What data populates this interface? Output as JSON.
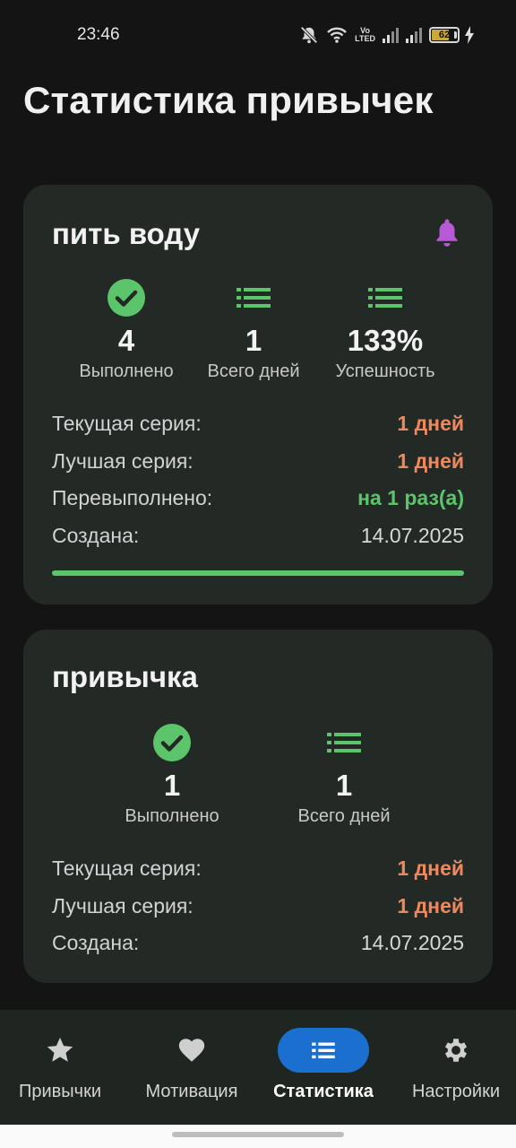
{
  "status_bar": {
    "time": "23:46",
    "volte_top": "Vo",
    "volte_bottom": "LTED",
    "battery": "62",
    "icons": [
      "mute-icon",
      "wifi-icon",
      "volte-icon",
      "signal-icon",
      "signal-icon",
      "battery-icon",
      "charging-icon"
    ]
  },
  "page": {
    "title": "Статистика привычек"
  },
  "colors": {
    "accent_green": "#5cc46a",
    "accent_orange": "#f0885e",
    "bell_purple": "#b85ad6",
    "nav_active": "#1a6fcf"
  },
  "habits": [
    {
      "name": "пить воду",
      "has_reminder": true,
      "stats": [
        {
          "icon": "check-circle-icon",
          "value": "4",
          "label": "Выполнено"
        },
        {
          "icon": "list-icon",
          "value": "1",
          "label": "Всего дней"
        },
        {
          "icon": "list-icon",
          "value": "133%",
          "label": "Успешность"
        }
      ],
      "rows": [
        {
          "label": "Текущая серия:",
          "value": "1 дней"
        },
        {
          "label": "Лучшая серия:",
          "value": "1 дней"
        },
        {
          "label": "Перевыполнено:",
          "value": "на 1 раз(а)"
        },
        {
          "label": "Создана:",
          "value": "14.07.2025"
        }
      ],
      "progress": 1.0
    },
    {
      "name": "привычка",
      "has_reminder": false,
      "stats": [
        {
          "icon": "check-circle-icon",
          "value": "1",
          "label": "Выполнено"
        },
        {
          "icon": "list-icon",
          "value": "1",
          "label": "Всего дней"
        }
      ],
      "rows": [
        {
          "label": "Текущая серия:",
          "value": "1 дней"
        },
        {
          "label": "Лучшая серия:",
          "value": "1 дней"
        },
        {
          "label": "Создана:",
          "value": "14.07.2025"
        }
      ]
    }
  ],
  "nav": {
    "items": [
      {
        "label": "Привычки",
        "icon": "star-icon",
        "active": false
      },
      {
        "label": "Мотивация",
        "icon": "heart-icon",
        "active": false
      },
      {
        "label": "Статистика",
        "icon": "list-icon",
        "active": true
      },
      {
        "label": "Настройки",
        "icon": "gear-icon",
        "active": false
      }
    ]
  }
}
